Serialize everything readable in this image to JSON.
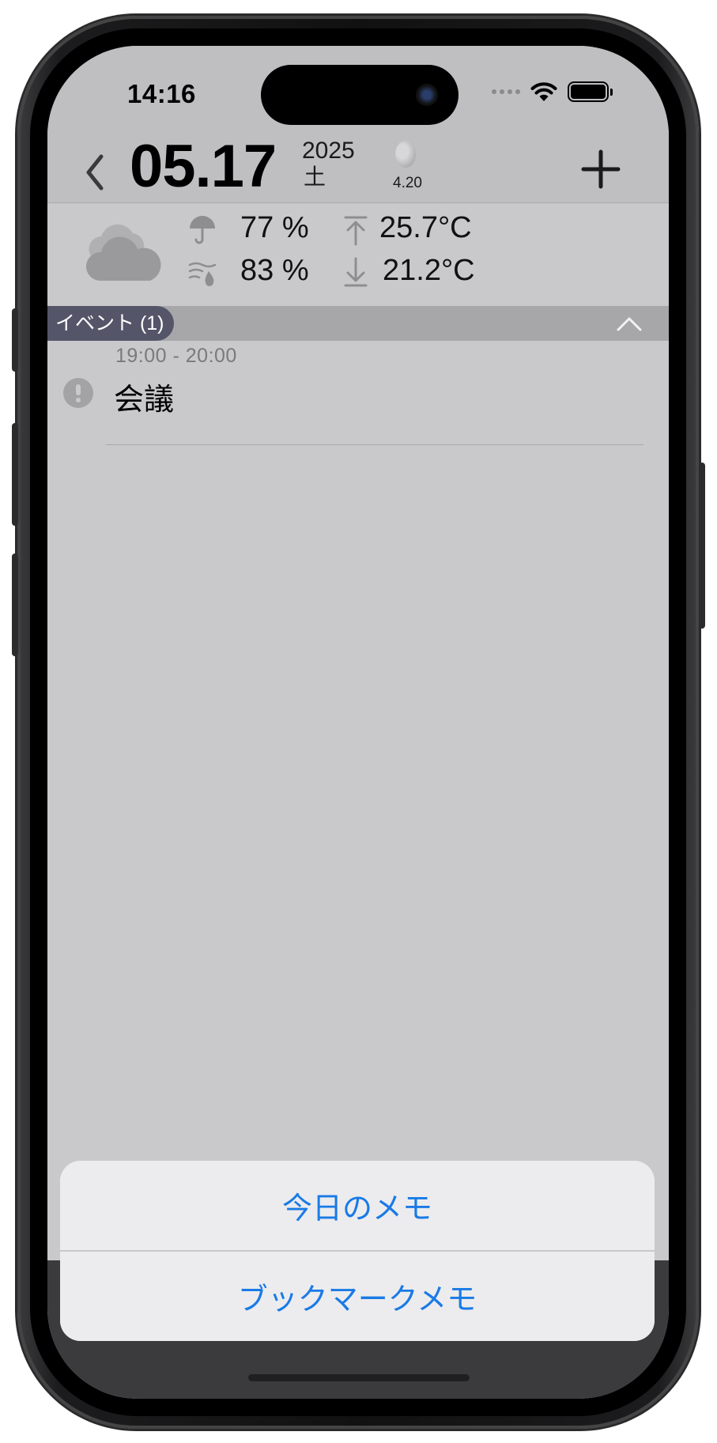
{
  "status_bar": {
    "time": "14:16"
  },
  "header": {
    "date": "05.17",
    "year": "2025",
    "weekday": "土",
    "moon_age": "4.20"
  },
  "weather": {
    "precipitation": "77 %",
    "humidity": "83 %",
    "high_temp": "25.7°C",
    "low_temp": "21.2°C"
  },
  "events_section": {
    "label": "イベント (1)",
    "events": [
      {
        "time": "19:00 - 20:00",
        "title": "会議"
      }
    ]
  },
  "action_sheet": {
    "today_memo": "今日のメモ",
    "bookmark_memo": "ブックマークメモ",
    "accent_color": "#1a7ae6"
  }
}
